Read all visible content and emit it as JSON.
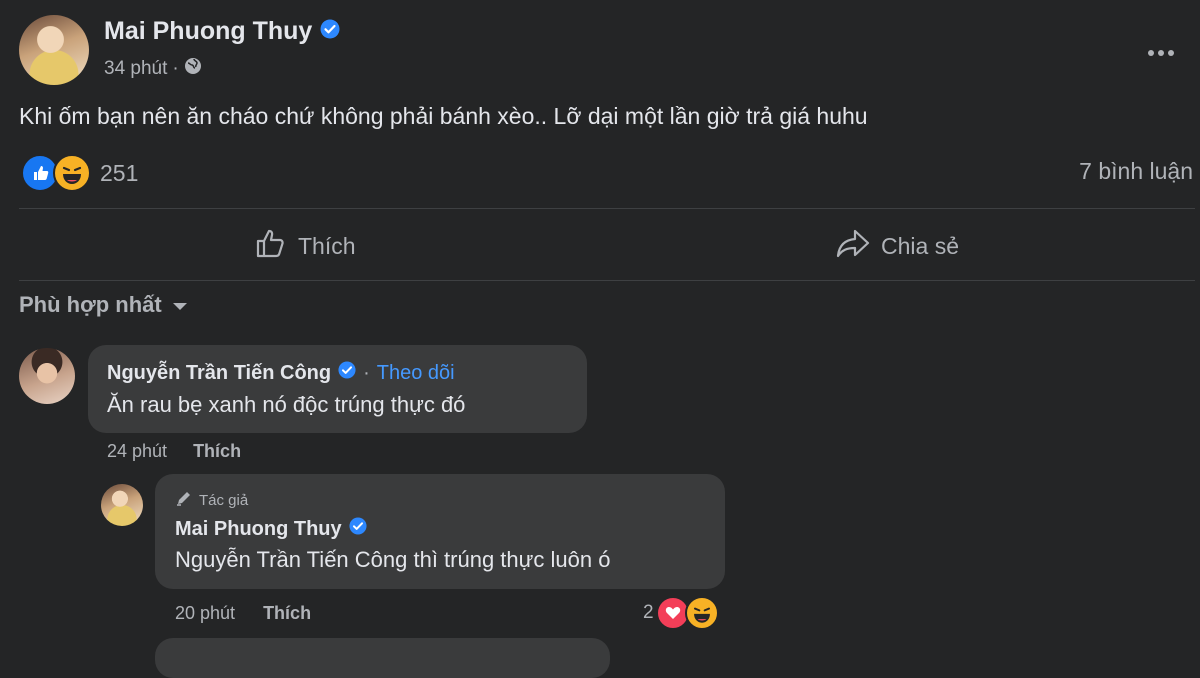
{
  "post": {
    "author": "Mai Phuong Thuy",
    "time": "34 phút",
    "separator": "·",
    "text": "Khi ốm bạn nên ăn cháo chứ không phải bánh xèo.. Lỡ dại một lần giờ trả giá huhu",
    "reaction_count": "251",
    "comment_count": "7 bình luận",
    "like_label": "Thích",
    "share_label": "Chia sẻ"
  },
  "sort": {
    "label": "Phù hợp nhất"
  },
  "comments": [
    {
      "author": "Nguyễn Trần Tiến Công",
      "separator": "·",
      "follow_label": "Theo dõi",
      "text": "Ăn rau bẹ xanh nó độc trúng thực đó",
      "time": "24 phút",
      "like_label": "Thích"
    },
    {
      "author_badge": "Tác giả",
      "author": "Mai Phuong Thuy",
      "text": "Nguyễn Trần Tiến Công thì trúng thực luôn ó",
      "time": "20 phút",
      "like_label": "Thích",
      "reaction_count": "2"
    }
  ],
  "colors": {
    "background": "#242526",
    "bubble": "#3a3b3c",
    "link": "#4599ff",
    "verified": "#2d88ff",
    "like_reaction": "#1877f2",
    "love_reaction": "#f33e58",
    "haha_reaction": "#f7b125"
  },
  "icons": [
    "verified-icon",
    "globe-icon",
    "more-icon",
    "like-reaction-icon",
    "haha-reaction-icon",
    "thumb-up-icon",
    "share-icon",
    "chevron-down-icon",
    "pencil-icon",
    "love-reaction-icon"
  ]
}
